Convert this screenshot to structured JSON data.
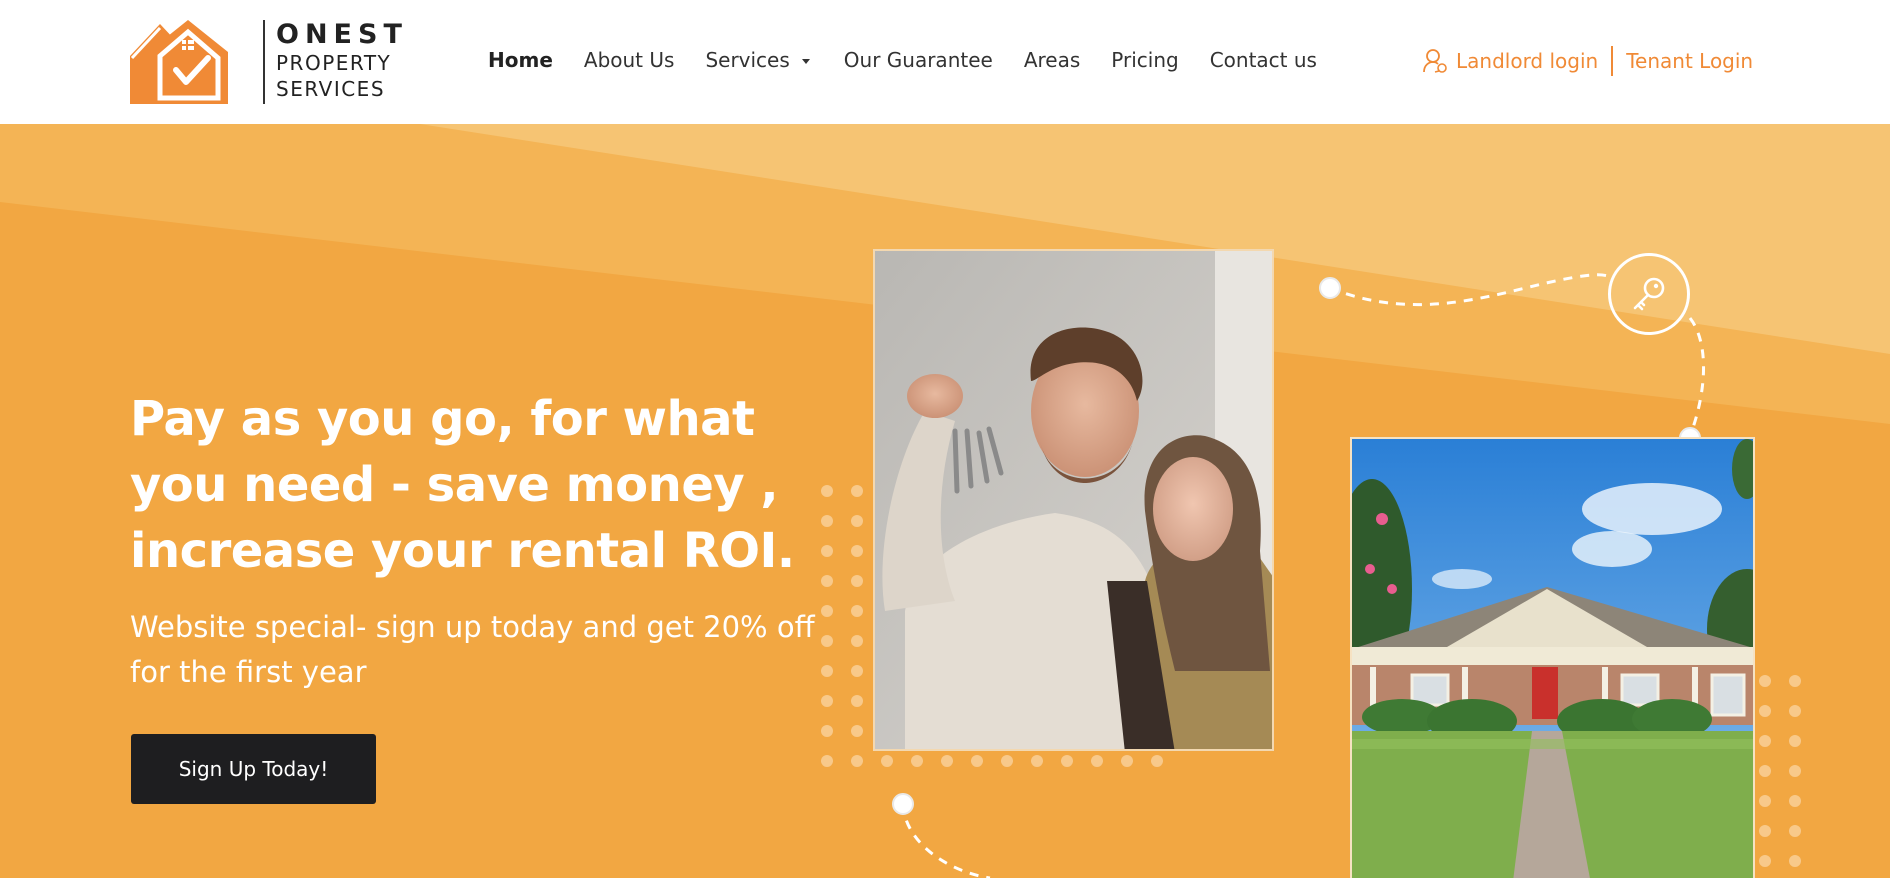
{
  "brand": {
    "name_line1": "ONEST",
    "name_line2": "PROPERTY",
    "name_line3": "SERVICES",
    "color_orange": "#F08A36",
    "color_dark": "#222222"
  },
  "nav": {
    "items": [
      {
        "label": "Home",
        "active": true
      },
      {
        "label": "About Us"
      },
      {
        "label": "Services",
        "has_dropdown": true
      },
      {
        "label": "Our Guarantee"
      },
      {
        "label": "Areas"
      },
      {
        "label": "Pricing"
      },
      {
        "label": "Contact us"
      }
    ]
  },
  "auth": {
    "landlord_label": "Landlord login",
    "tenant_label": "Tenant Login",
    "icon": "user-icon"
  },
  "hero": {
    "headline": "Pay as you go, for what you need - save money , increase your rental ROI.",
    "subline": "Website special- sign up today and get 20% off for the first year",
    "cta_label": "Sign Up Today!",
    "background_color": "#F2A742",
    "cta_color": "#1E1E20",
    "photo_couple": "couple-holding-keys-photo",
    "photo_house": "house-exterior-photo",
    "badge_icon": "key-icon"
  }
}
